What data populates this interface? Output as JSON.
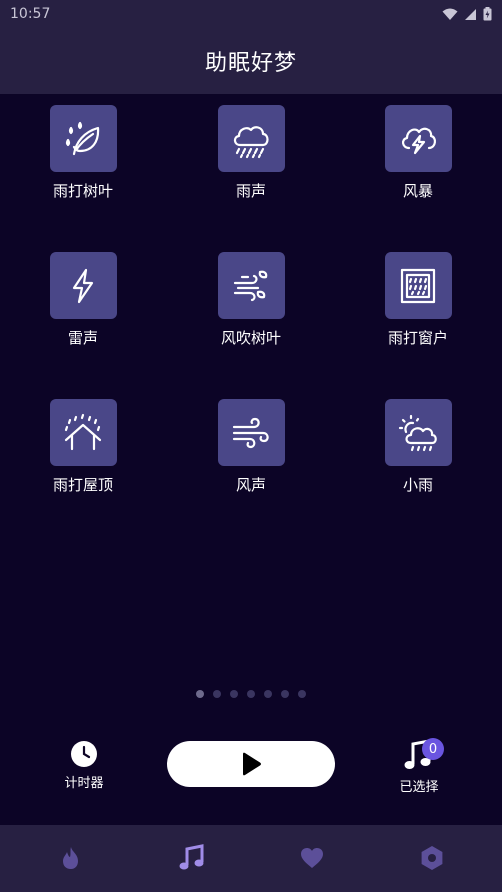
{
  "status_bar": {
    "time": "10:57"
  },
  "header": {
    "title": "助眠好梦"
  },
  "sounds": [
    {
      "label": "雨打树叶",
      "icon": "leaf-rain-icon"
    },
    {
      "label": "雨声",
      "icon": "cloud-rain-icon"
    },
    {
      "label": "风暴",
      "icon": "storm-cloud-icon"
    },
    {
      "label": "雷声",
      "icon": "lightning-icon"
    },
    {
      "label": "风吹树叶",
      "icon": "wind-leaves-icon"
    },
    {
      "label": "雨打窗户",
      "icon": "rain-window-icon"
    },
    {
      "label": "雨打屋顶",
      "icon": "rain-roof-icon"
    },
    {
      "label": "风声",
      "icon": "wind-icon"
    },
    {
      "label": "小雨",
      "icon": "sun-cloud-rain-icon"
    }
  ],
  "pager": {
    "count": 7,
    "active": 0
  },
  "controls": {
    "timer_label": "计时器",
    "selected_label": "已选择",
    "selected_count": "0"
  },
  "bottom_nav": {
    "items": [
      "fire-icon",
      "music-note-icon",
      "heart-icon",
      "hexagon-settings-icon"
    ],
    "active": 1
  },
  "colors": {
    "background": "#0c0426",
    "bar": "#272042",
    "tile": "#4a4788",
    "nav_active": "#a08ce8",
    "nav_inactive": "#5c4f99",
    "badge": "#6a55e0"
  }
}
